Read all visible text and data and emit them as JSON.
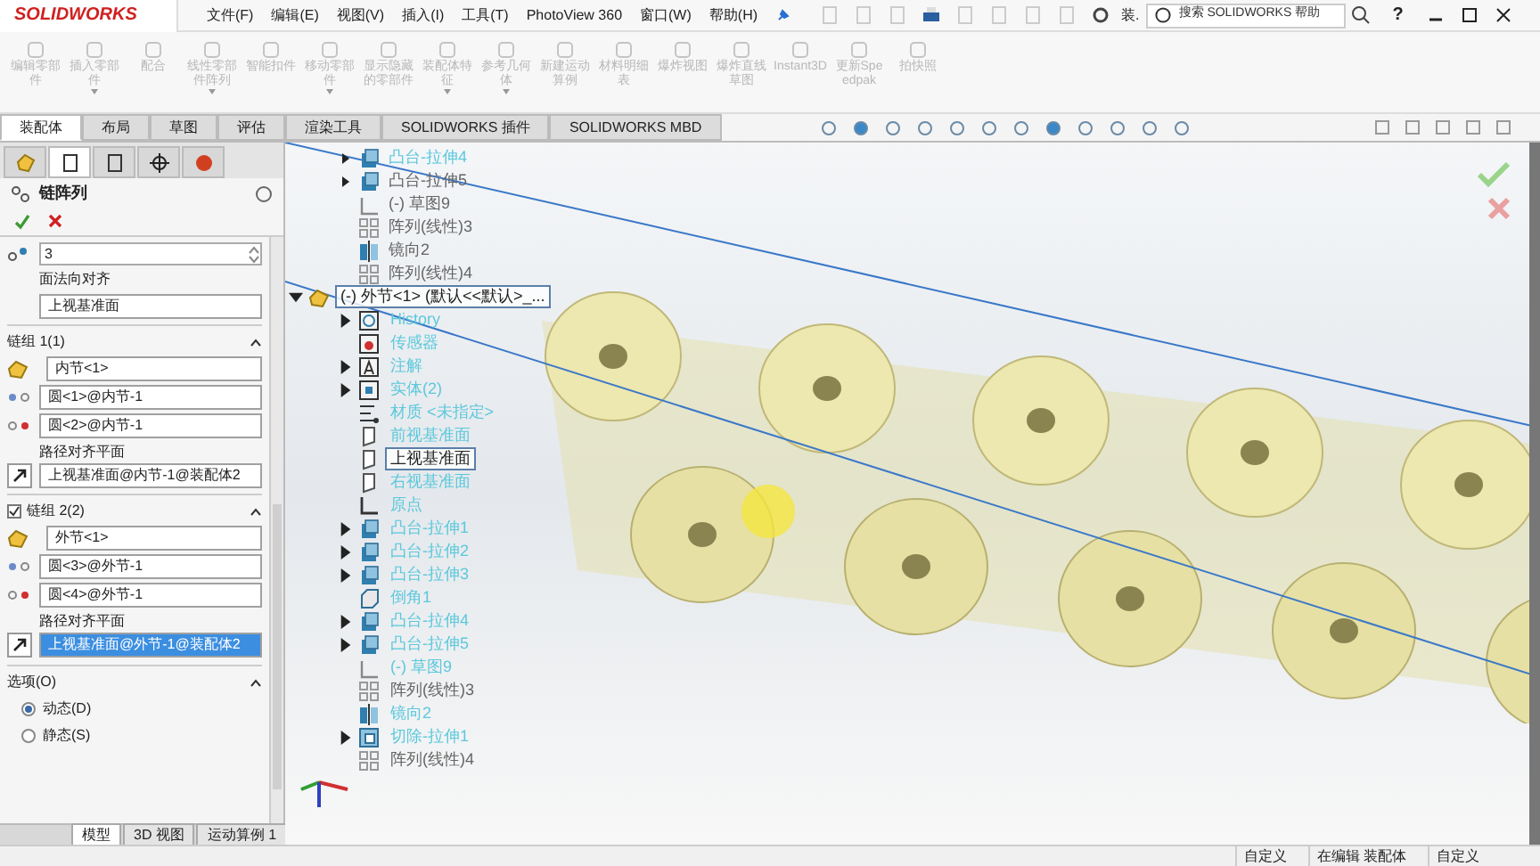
{
  "app": {
    "logo": "SOLIDWORKS",
    "menus": [
      "文件(F)",
      "编辑(E)",
      "视图(V)",
      "插入(I)",
      "工具(T)",
      "PhotoView 360",
      "窗口(W)",
      "帮助(H)"
    ],
    "doc_title": "装.",
    "search": {
      "placeholder": "搜索 SOLIDWORKS 帮助"
    },
    "help": "?"
  },
  "ribbon": [
    {
      "label": "编辑零部件",
      "dropdown": false
    },
    {
      "label": "插入零部件",
      "dropdown": true
    },
    {
      "label": "配合",
      "dropdown": false
    },
    {
      "label": "线性零部件阵列",
      "dropdown": true
    },
    {
      "label": "智能扣件",
      "dropdown": false
    },
    {
      "label": "移动零部件",
      "dropdown": true
    },
    {
      "label": "显示隐藏的零部件",
      "dropdown": false
    },
    {
      "label": "装配体特征",
      "dropdown": true
    },
    {
      "label": "参考几何体",
      "dropdown": true
    },
    {
      "label": "新建运动算例",
      "dropdown": false
    },
    {
      "label": "材料明细表",
      "dropdown": false
    },
    {
      "label": "爆炸视图",
      "dropdown": false
    },
    {
      "label": "爆炸直线草图",
      "dropdown": false
    },
    {
      "label": "Instant3D",
      "dropdown": false
    },
    {
      "label": "更新Speedpak",
      "dropdown": false
    },
    {
      "label": "拍快照",
      "dropdown": false
    }
  ],
  "tabs": [
    {
      "label": "装配体",
      "selected": true
    },
    {
      "label": "布局",
      "selected": false
    },
    {
      "label": "草图",
      "selected": false
    },
    {
      "label": "评估",
      "selected": false
    },
    {
      "label": "渲染工具",
      "selected": false
    },
    {
      "label": "SOLIDWORKS 插件",
      "selected": false
    },
    {
      "label": "SOLIDWORKS MBD",
      "selected": false
    }
  ],
  "panel_tabs": [
    {
      "selected": false
    },
    {
      "selected": true
    },
    {
      "selected": false
    },
    {
      "selected": false
    },
    {
      "selected": false
    }
  ],
  "property_manager": {
    "title": "链阵列",
    "count": "3",
    "normal_label": "面法向对齐",
    "normal_value": "上视基准面",
    "groups": [
      {
        "title": "链组 1(1)",
        "kind": "plain",
        "component": "内节<1>",
        "point_1": "圆<1>@内节-1",
        "point_2": "圆<2>@内节-1",
        "plane_label": "路径对齐平面",
        "plane": "上视基准面@内节-1@装配体2",
        "plane_selected": false
      },
      {
        "title": "链组 2(2)",
        "kind": "checkbox",
        "checked": true,
        "component": "外节<1>",
        "point_1": "圆<3>@外节-1",
        "point_2": "圆<4>@外节-1",
        "plane_label": "路径对齐平面",
        "plane": "上视基准面@外节-1@装配体2",
        "plane_selected": true
      }
    ],
    "options": {
      "title": "选项(O)",
      "radios": [
        {
          "label": "动态(D)",
          "selected": true
        },
        {
          "label": "静态(S)",
          "selected": false
        }
      ]
    }
  },
  "tree_above": [
    {
      "label": "凸台-拉伸4",
      "kind": "extrude",
      "expandable": true,
      "color": "#5cc8dc"
    },
    {
      "label": "凸台-拉伸5",
      "kind": "extrude",
      "expandable": true,
      "color": "#666666"
    },
    {
      "label": "(-) 草图9",
      "kind": "sketch",
      "expandable": false,
      "color": "#666666"
    },
    {
      "label": "阵列(线性)3",
      "kind": "pattern",
      "expandable": false,
      "color": "#666666"
    },
    {
      "label": "镜向2",
      "kind": "mirror",
      "expandable": false,
      "color": "#666666"
    },
    {
      "label": "阵列(线性)4",
      "kind": "pattern",
      "expandable": false,
      "color": "#666666"
    }
  ],
  "tree": [
    {
      "label": "(-) 外节<1> (默认<<默认>_...",
      "kind": "component",
      "expandable": true,
      "expanded": true,
      "selected": true,
      "color": "#222222",
      "children": [
        {
          "label": "History",
          "kind": "history",
          "expandable": true,
          "expanded": false,
          "selected": false,
          "color": "#5cc8dc"
        },
        {
          "label": "传感器",
          "kind": "sensor",
          "expandable": false,
          "selected": false,
          "color": "#5cc8dc"
        },
        {
          "label": "注解",
          "kind": "annotation",
          "expandable": true,
          "expanded": false,
          "selected": false,
          "color": "#5cc8dc"
        },
        {
          "label": "实体(2)",
          "kind": "solid",
          "expandable": true,
          "expanded": false,
          "selected": false,
          "color": "#5cc8dc"
        },
        {
          "label": "材质 <未指定>",
          "kind": "material",
          "expandable": false,
          "selected": false,
          "color": "#5cc8dc"
        },
        {
          "label": "前视基准面",
          "kind": "plane",
          "expandable": false,
          "selected": false,
          "color": "#5cc8dc"
        },
        {
          "label": "上视基准面",
          "kind": "plane",
          "expandable": false,
          "selected": true,
          "color": "#222222"
        },
        {
          "label": "右视基准面",
          "kind": "plane",
          "expandable": false,
          "selected": false,
          "color": "#5cc8dc"
        },
        {
          "label": "原点",
          "kind": "origin",
          "expandable": false,
          "selected": false,
          "color": "#5cc8dc"
        },
        {
          "label": "凸台-拉伸1",
          "kind": "extrude",
          "expandable": true,
          "expanded": false,
          "selected": false,
          "color": "#5cc8dc"
        },
        {
          "label": "凸台-拉伸2",
          "kind": "extrude",
          "expandable": true,
          "expanded": false,
          "selected": false,
          "color": "#5cc8dc"
        },
        {
          "label": "凸台-拉伸3",
          "kind": "extrude",
          "expandable": true,
          "expanded": false,
          "selected": false,
          "color": "#5cc8dc"
        },
        {
          "label": "倒角1",
          "kind": "chamfer",
          "expandable": false,
          "selected": false,
          "color": "#5cc8dc"
        },
        {
          "label": "凸台-拉伸4",
          "kind": "extrude",
          "expandable": true,
          "expanded": false,
          "selected": false,
          "color": "#5cc8dc"
        },
        {
          "label": "凸台-拉伸5",
          "kind": "extrude",
          "expandable": true,
          "expanded": false,
          "selected": false,
          "color": "#5cc8dc"
        },
        {
          "label": "(-) 草图9",
          "kind": "sketch",
          "expandable": false,
          "selected": false,
          "color": "#5cc8dc"
        },
        {
          "label": "阵列(线性)3",
          "kind": "pattern",
          "expandable": false,
          "selected": false,
          "color": "#666666"
        },
        {
          "label": "镜向2",
          "kind": "mirror",
          "expandable": false,
          "selected": false,
          "color": "#5cc8dc"
        },
        {
          "label": "切除-拉伸1",
          "kind": "cut",
          "expandable": true,
          "expanded": false,
          "selected": false,
          "color": "#5cc8dc"
        },
        {
          "label": "阵列(线性)4",
          "kind": "pattern",
          "expandable": false,
          "selected": false,
          "color": "#666666"
        }
      ]
    }
  ],
  "bottom_tabs": [
    {
      "label": "模型",
      "selected": true
    },
    {
      "label": "3D 视图",
      "selected": false
    },
    {
      "label": "运动算例 1",
      "selected": false
    }
  ],
  "status_bar": [
    "自定义",
    "在编辑 装配体",
    "自定义"
  ]
}
